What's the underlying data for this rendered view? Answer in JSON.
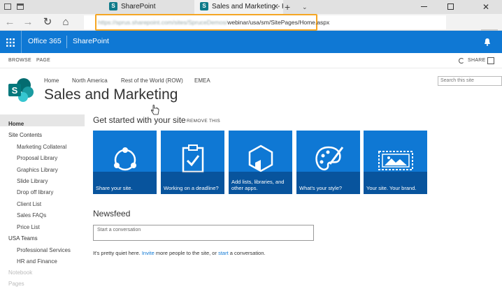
{
  "browser": {
    "tabs": [
      {
        "label": "SharePoint",
        "active": false
      },
      {
        "label": "Sales and Marketing - H",
        "active": true
      }
    ],
    "url_host_blurred": "https://sprus.sharepoint.com/sites/SpruceDemos/",
    "url_path": "webinar/usa/sm/SitePages/Home.aspx"
  },
  "suite_bar": {
    "app_launcher_icon": "waffle-icon",
    "office365": "Office 365",
    "sharepoint": "SharePoint",
    "color": "#0f78d4"
  },
  "ribbon": {
    "tabs": [
      "BROWSE",
      "PAGE"
    ],
    "share": "SHARE"
  },
  "top_nav": [
    "Home",
    "North America",
    "Rest of the World (ROW)",
    "EMEA"
  ],
  "site": {
    "title": "Sales and Marketing",
    "search_placeholder": "Search this site"
  },
  "left_nav": {
    "items": [
      {
        "label": "Home",
        "level": 1,
        "selected": true
      },
      {
        "label": "Site Contents",
        "level": 1
      },
      {
        "label": "Marketing Collateral",
        "level": 2
      },
      {
        "label": "Proposal Library",
        "level": 2
      },
      {
        "label": "Graphics Library",
        "level": 2
      },
      {
        "label": "Slide Library",
        "level": 2
      },
      {
        "label": "Drop off library",
        "level": 2
      },
      {
        "label": "Client List",
        "level": 2
      },
      {
        "label": "Sales FAQs",
        "level": 2
      },
      {
        "label": "Price List",
        "level": 2
      },
      {
        "label": "USA Teams",
        "level": 1
      },
      {
        "label": "Professional Services",
        "level": 2
      },
      {
        "label": "HR and Finance",
        "level": 2
      },
      {
        "label": "Notebook",
        "level": 1,
        "dim": true
      },
      {
        "label": "Pages",
        "level": 1,
        "dim": true
      }
    ]
  },
  "get_started": {
    "title": "Get started with your site",
    "remove": "REMOVE THIS",
    "tiles": [
      {
        "label": "Share your site.",
        "icon": "share-network-icon"
      },
      {
        "label": "Working on a deadline?",
        "icon": "clipboard-check-icon"
      },
      {
        "label": "Add lists, libraries, and other apps.",
        "icon": "add-app-hexagon-icon"
      },
      {
        "label": "What's your style?",
        "icon": "palette-brush-icon"
      },
      {
        "label": "Your site. Your brand.",
        "icon": "image-frame-icon"
      }
    ]
  },
  "newsfeed": {
    "title": "Newsfeed",
    "placeholder": "Start a conversation",
    "quiet_prefix": "It's pretty quiet here. ",
    "invite": "Invite",
    "quiet_mid": " more people to the site, or ",
    "start": "start",
    "quiet_suffix": " a conversation."
  }
}
